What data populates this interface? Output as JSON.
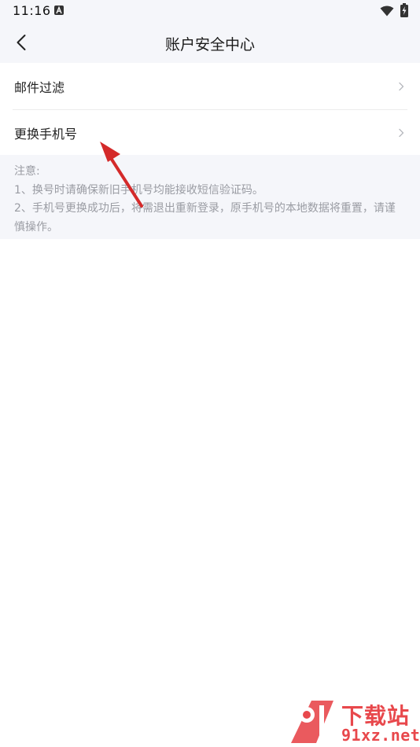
{
  "status_bar": {
    "time": "11:16",
    "icons": [
      "a-letter-icon",
      "wifi-icon",
      "battery-charging-icon"
    ]
  },
  "nav": {
    "title": "账户安全中心",
    "back_icon": "chevron-left-icon"
  },
  "menu": {
    "items": [
      {
        "label": "邮件过滤"
      },
      {
        "label": "更换手机号"
      }
    ]
  },
  "notice": {
    "heading": "注意:",
    "line1": "1、换号时请确保新旧手机号均能接收短信验证码。",
    "line2": "2、手机号更换成功后，将需退出重新登录，原手机号的本地数据将重置，请谨慎操作。"
  },
  "watermark": {
    "cn": "下载站",
    "url": "91xz.net",
    "logo_text": "91"
  },
  "colors": {
    "page_bg": "#ffffff",
    "header_bg": "#f5f6fa",
    "notice_text": "#9a9ca3",
    "arrow": "#d42a2a",
    "watermark": "#e8484c"
  }
}
